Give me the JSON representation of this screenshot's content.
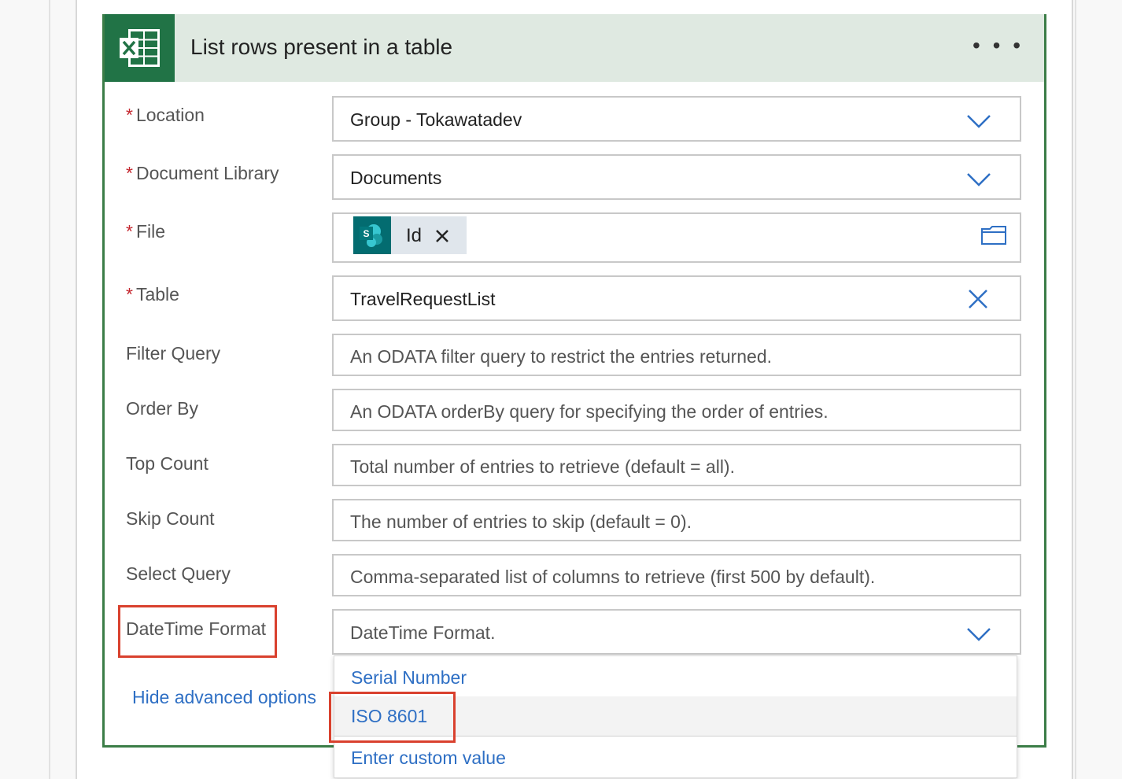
{
  "card": {
    "title": "List rows present in a table",
    "more_label": "• • •"
  },
  "fields": {
    "location": {
      "label": "Location",
      "required": true,
      "value": "Group - Tokawatadev"
    },
    "document_library": {
      "label": "Document Library",
      "required": true,
      "value": "Documents"
    },
    "file": {
      "label": "File",
      "required": true,
      "token_label": "Id",
      "token_icon_letter": "S"
    },
    "table": {
      "label": "Table",
      "required": true,
      "value": "TravelRequestList"
    },
    "filter_query": {
      "label": "Filter Query",
      "placeholder": "An ODATA filter query to restrict the entries returned."
    },
    "order_by": {
      "label": "Order By",
      "placeholder": "An ODATA orderBy query for specifying the order of entries."
    },
    "top_count": {
      "label": "Top Count",
      "placeholder": "Total number of entries to retrieve (default = all)."
    },
    "skip_count": {
      "label": "Skip Count",
      "placeholder": "The number of entries to skip (default = 0)."
    },
    "select_query": {
      "label": "Select Query",
      "placeholder": "Comma-separated list of columns to retrieve (first 500 by default)."
    },
    "datetime_format": {
      "label": "DateTime Format",
      "placeholder": "DateTime Format."
    }
  },
  "required_mark": "*",
  "hide_advanced_label": "Hide advanced options",
  "dropdown": {
    "options": [
      "Serial Number",
      "ISO 8601",
      "Enter custom value"
    ],
    "highlighted": "ISO 8601"
  },
  "colors": {
    "accent_blue": "#2e6fc4",
    "card_border": "#3b7d47",
    "header_bg": "#dfe9e1",
    "excel_green": "#217346",
    "sharepoint_teal": "#036c70",
    "required_red": "#c4262e",
    "annotation_red": "#d9412e"
  },
  "icons": {
    "header": "excel-icon",
    "dropdown": "chevron-down-icon",
    "clear": "close-icon",
    "token": "sharepoint-icon",
    "file_picker": "folder-icon"
  }
}
